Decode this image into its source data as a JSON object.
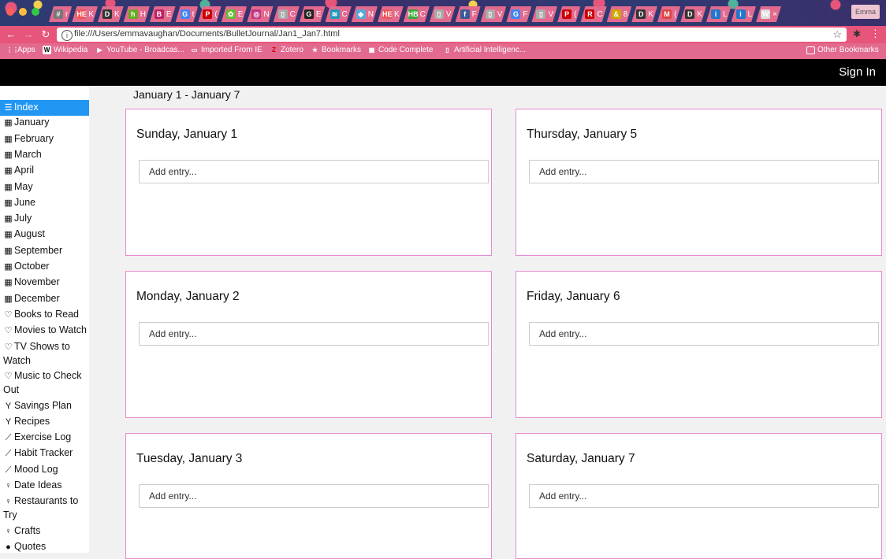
{
  "browser": {
    "tabs": [
      {
        "fav": "#",
        "color": "#777",
        "label": "r"
      },
      {
        "fav": "HE",
        "color": "#e55",
        "label": "K"
      },
      {
        "fav": "D",
        "color": "#333",
        "label": "K"
      },
      {
        "fav": "h",
        "color": "#6a2",
        "label": "H"
      },
      {
        "fav": "B",
        "color": "#b26",
        "label": "E"
      },
      {
        "fav": "G",
        "color": "#4285f4",
        "label": "t"
      },
      {
        "fav": "P",
        "color": "#c00",
        "label": "("
      },
      {
        "fav": "✿",
        "color": "#6b3",
        "label": "E"
      },
      {
        "fav": "◎",
        "color": "#c13584",
        "label": "N"
      },
      {
        "fav": "▯",
        "color": "#aaa",
        "label": "C"
      },
      {
        "fav": "G",
        "color": "#222",
        "label": "E"
      },
      {
        "fav": "≋",
        "color": "#29b",
        "label": "C"
      },
      {
        "fav": "◆",
        "color": "#5ad",
        "label": "N"
      },
      {
        "fav": "HE",
        "color": "#e55",
        "label": "K"
      },
      {
        "fav": "HB",
        "color": "#3a3",
        "label": "C"
      },
      {
        "fav": "▯",
        "color": "#aaa",
        "label": "V"
      },
      {
        "fav": "f",
        "color": "#3b5998",
        "label": "F"
      },
      {
        "fav": "▯",
        "color": "#aaa",
        "label": "V"
      },
      {
        "fav": "G",
        "color": "#4285f4",
        "label": "F"
      },
      {
        "fav": "▯",
        "color": "#aaa",
        "label": "V"
      },
      {
        "fav": "P",
        "color": "#c00",
        "label": "("
      },
      {
        "fav": "R",
        "color": "#c00",
        "label": "C"
      },
      {
        "fav": "&",
        "color": "#ca0",
        "label": "8"
      },
      {
        "fav": "D",
        "color": "#333",
        "label": "K"
      },
      {
        "fav": "M",
        "color": "#d44",
        "label": "("
      },
      {
        "fav": "D",
        "color": "#333",
        "label": "K"
      },
      {
        "fav": "i",
        "color": "#27c",
        "label": "L"
      },
      {
        "fav": "i",
        "color": "#27c",
        "label": "L"
      },
      {
        "fav": "W",
        "color": "#ddd",
        "label": "×"
      }
    ],
    "profile": "Emma",
    "url": "file:///Users/emmavaughan/Documents/BulletJournal/Jan1_Jan7.html",
    "bookmarks": [
      {
        "icon": "⋮⋮",
        "label": "Apps"
      },
      {
        "icon": "W",
        "label": "Wikipedia"
      },
      {
        "icon": "▶",
        "label": "YouTube - Broadcas..."
      },
      {
        "icon": "▭",
        "label": "Imported From IE"
      },
      {
        "icon": "Z",
        "label": "Zotero"
      },
      {
        "icon": "★",
        "label": "Bookmarks"
      },
      {
        "icon": "▦",
        "label": "Code Complete"
      },
      {
        "icon": "▯",
        "label": "Artificial Intelligenc..."
      }
    ],
    "other_bookmarks": "Other Bookmarks"
  },
  "header": {
    "sign_in": "Sign In"
  },
  "sidebar": {
    "items": [
      {
        "icon": "list-icon",
        "glyph": "☰",
        "label": "Index",
        "active": true
      },
      {
        "icon": "calendar-icon",
        "glyph": "▦",
        "label": "January"
      },
      {
        "icon": "calendar-icon",
        "glyph": "▦",
        "label": "February"
      },
      {
        "icon": "calendar-icon",
        "glyph": "▦",
        "label": "March"
      },
      {
        "icon": "calendar-icon",
        "glyph": "▦",
        "label": "April"
      },
      {
        "icon": "calendar-icon",
        "glyph": "▦",
        "label": "May"
      },
      {
        "icon": "calendar-icon",
        "glyph": "▦",
        "label": "June"
      },
      {
        "icon": "calendar-icon",
        "glyph": "▦",
        "label": "July"
      },
      {
        "icon": "calendar-icon",
        "glyph": "▦",
        "label": "August"
      },
      {
        "icon": "calendar-icon",
        "glyph": "▦",
        "label": "September"
      },
      {
        "icon": "calendar-icon",
        "glyph": "▦",
        "label": "October"
      },
      {
        "icon": "calendar-icon",
        "glyph": "▦",
        "label": "November"
      },
      {
        "icon": "calendar-icon",
        "glyph": "▦",
        "label": "December"
      },
      {
        "icon": "heart-icon",
        "glyph": "♡",
        "label": "Books to Read"
      },
      {
        "icon": "heart-icon",
        "glyph": "♡",
        "label": "Movies to Watch"
      },
      {
        "icon": "heart-icon",
        "glyph": "♡",
        "label": "TV Shows to Watch",
        "lines": 2
      },
      {
        "icon": "heart-icon",
        "glyph": "♡",
        "label": "Music to Check Out",
        "lines": 2
      },
      {
        "icon": "glass-icon",
        "glyph": "Y",
        "label": "Savings Plan"
      },
      {
        "icon": "glass-icon",
        "glyph": "Y",
        "label": "Recipes"
      },
      {
        "icon": "line-chart-icon",
        "glyph": "⟋",
        "label": "Exercise Log"
      },
      {
        "icon": "line-chart-icon",
        "glyph": "⟋",
        "label": "Habit Tracker"
      },
      {
        "icon": "line-chart-icon",
        "glyph": "⟋",
        "label": "Mood Log"
      },
      {
        "icon": "lightbulb-icon",
        "glyph": "♀",
        "label": "Date Ideas"
      },
      {
        "icon": "lightbulb-icon",
        "glyph": "♀",
        "label": "Restaurants to Try",
        "lines": 2
      },
      {
        "icon": "lightbulb-icon",
        "glyph": "♀",
        "label": "Crafts"
      },
      {
        "icon": "globe-icon",
        "glyph": "●",
        "label": "Quotes"
      }
    ]
  },
  "main": {
    "title": "January 1 - January 7",
    "days": [
      {
        "date": "Sunday, January 1",
        "placeholder": "Add entry..."
      },
      {
        "date": "Thursday, January 5",
        "placeholder": "Add entry..."
      },
      {
        "date": "Monday, January 2",
        "placeholder": "Add entry..."
      },
      {
        "date": "Friday, January 6",
        "placeholder": "Add entry..."
      },
      {
        "date": "Tuesday, January 3",
        "placeholder": "Add entry..."
      },
      {
        "date": "Saturday, January 7",
        "placeholder": "Add entry..."
      }
    ]
  }
}
